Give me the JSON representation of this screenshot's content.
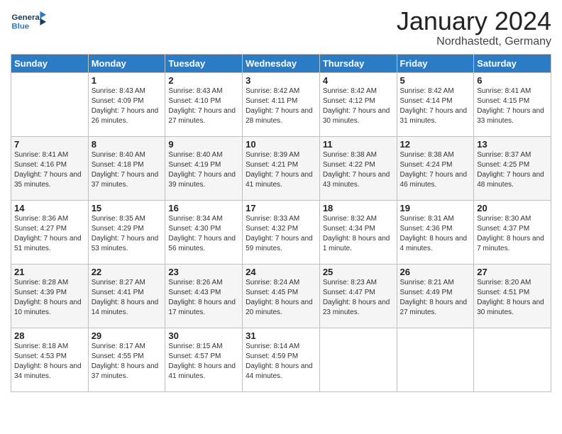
{
  "header": {
    "logo_general": "General",
    "logo_blue": "Blue",
    "month_title": "January 2024",
    "location": "Nordhastedt, Germany"
  },
  "weekdays": [
    "Sunday",
    "Monday",
    "Tuesday",
    "Wednesday",
    "Thursday",
    "Friday",
    "Saturday"
  ],
  "weeks": [
    [
      {
        "day": "",
        "sunrise": "",
        "sunset": "",
        "daylight": ""
      },
      {
        "day": "1",
        "sunrise": "Sunrise: 8:43 AM",
        "sunset": "Sunset: 4:09 PM",
        "daylight": "Daylight: 7 hours and 26 minutes."
      },
      {
        "day": "2",
        "sunrise": "Sunrise: 8:43 AM",
        "sunset": "Sunset: 4:10 PM",
        "daylight": "Daylight: 7 hours and 27 minutes."
      },
      {
        "day": "3",
        "sunrise": "Sunrise: 8:42 AM",
        "sunset": "Sunset: 4:11 PM",
        "daylight": "Daylight: 7 hours and 28 minutes."
      },
      {
        "day": "4",
        "sunrise": "Sunrise: 8:42 AM",
        "sunset": "Sunset: 4:12 PM",
        "daylight": "Daylight: 7 hours and 30 minutes."
      },
      {
        "day": "5",
        "sunrise": "Sunrise: 8:42 AM",
        "sunset": "Sunset: 4:14 PM",
        "daylight": "Daylight: 7 hours and 31 minutes."
      },
      {
        "day": "6",
        "sunrise": "Sunrise: 8:41 AM",
        "sunset": "Sunset: 4:15 PM",
        "daylight": "Daylight: 7 hours and 33 minutes."
      }
    ],
    [
      {
        "day": "7",
        "sunrise": "Sunrise: 8:41 AM",
        "sunset": "Sunset: 4:16 PM",
        "daylight": "Daylight: 7 hours and 35 minutes."
      },
      {
        "day": "8",
        "sunrise": "Sunrise: 8:40 AM",
        "sunset": "Sunset: 4:18 PM",
        "daylight": "Daylight: 7 hours and 37 minutes."
      },
      {
        "day": "9",
        "sunrise": "Sunrise: 8:40 AM",
        "sunset": "Sunset: 4:19 PM",
        "daylight": "Daylight: 7 hours and 39 minutes."
      },
      {
        "day": "10",
        "sunrise": "Sunrise: 8:39 AM",
        "sunset": "Sunset: 4:21 PM",
        "daylight": "Daylight: 7 hours and 41 minutes."
      },
      {
        "day": "11",
        "sunrise": "Sunrise: 8:38 AM",
        "sunset": "Sunset: 4:22 PM",
        "daylight": "Daylight: 7 hours and 43 minutes."
      },
      {
        "day": "12",
        "sunrise": "Sunrise: 8:38 AM",
        "sunset": "Sunset: 4:24 PM",
        "daylight": "Daylight: 7 hours and 46 minutes."
      },
      {
        "day": "13",
        "sunrise": "Sunrise: 8:37 AM",
        "sunset": "Sunset: 4:25 PM",
        "daylight": "Daylight: 7 hours and 48 minutes."
      }
    ],
    [
      {
        "day": "14",
        "sunrise": "Sunrise: 8:36 AM",
        "sunset": "Sunset: 4:27 PM",
        "daylight": "Daylight: 7 hours and 51 minutes."
      },
      {
        "day": "15",
        "sunrise": "Sunrise: 8:35 AM",
        "sunset": "Sunset: 4:29 PM",
        "daylight": "Daylight: 7 hours and 53 minutes."
      },
      {
        "day": "16",
        "sunrise": "Sunrise: 8:34 AM",
        "sunset": "Sunset: 4:30 PM",
        "daylight": "Daylight: 7 hours and 56 minutes."
      },
      {
        "day": "17",
        "sunrise": "Sunrise: 8:33 AM",
        "sunset": "Sunset: 4:32 PM",
        "daylight": "Daylight: 7 hours and 59 minutes."
      },
      {
        "day": "18",
        "sunrise": "Sunrise: 8:32 AM",
        "sunset": "Sunset: 4:34 PM",
        "daylight": "Daylight: 8 hours and 1 minute."
      },
      {
        "day": "19",
        "sunrise": "Sunrise: 8:31 AM",
        "sunset": "Sunset: 4:36 PM",
        "daylight": "Daylight: 8 hours and 4 minutes."
      },
      {
        "day": "20",
        "sunrise": "Sunrise: 8:30 AM",
        "sunset": "Sunset: 4:37 PM",
        "daylight": "Daylight: 8 hours and 7 minutes."
      }
    ],
    [
      {
        "day": "21",
        "sunrise": "Sunrise: 8:28 AM",
        "sunset": "Sunset: 4:39 PM",
        "daylight": "Daylight: 8 hours and 10 minutes."
      },
      {
        "day": "22",
        "sunrise": "Sunrise: 8:27 AM",
        "sunset": "Sunset: 4:41 PM",
        "daylight": "Daylight: 8 hours and 14 minutes."
      },
      {
        "day": "23",
        "sunrise": "Sunrise: 8:26 AM",
        "sunset": "Sunset: 4:43 PM",
        "daylight": "Daylight: 8 hours and 17 minutes."
      },
      {
        "day": "24",
        "sunrise": "Sunrise: 8:24 AM",
        "sunset": "Sunset: 4:45 PM",
        "daylight": "Daylight: 8 hours and 20 minutes."
      },
      {
        "day": "25",
        "sunrise": "Sunrise: 8:23 AM",
        "sunset": "Sunset: 4:47 PM",
        "daylight": "Daylight: 8 hours and 23 minutes."
      },
      {
        "day": "26",
        "sunrise": "Sunrise: 8:21 AM",
        "sunset": "Sunset: 4:49 PM",
        "daylight": "Daylight: 8 hours and 27 minutes."
      },
      {
        "day": "27",
        "sunrise": "Sunrise: 8:20 AM",
        "sunset": "Sunset: 4:51 PM",
        "daylight": "Daylight: 8 hours and 30 minutes."
      }
    ],
    [
      {
        "day": "28",
        "sunrise": "Sunrise: 8:18 AM",
        "sunset": "Sunset: 4:53 PM",
        "daylight": "Daylight: 8 hours and 34 minutes."
      },
      {
        "day": "29",
        "sunrise": "Sunrise: 8:17 AM",
        "sunset": "Sunset: 4:55 PM",
        "daylight": "Daylight: 8 hours and 37 minutes."
      },
      {
        "day": "30",
        "sunrise": "Sunrise: 8:15 AM",
        "sunset": "Sunset: 4:57 PM",
        "daylight": "Daylight: 8 hours and 41 minutes."
      },
      {
        "day": "31",
        "sunrise": "Sunrise: 8:14 AM",
        "sunset": "Sunset: 4:59 PM",
        "daylight": "Daylight: 8 hours and 44 minutes."
      },
      {
        "day": "",
        "sunrise": "",
        "sunset": "",
        "daylight": ""
      },
      {
        "day": "",
        "sunrise": "",
        "sunset": "",
        "daylight": ""
      },
      {
        "day": "",
        "sunrise": "",
        "sunset": "",
        "daylight": ""
      }
    ]
  ]
}
